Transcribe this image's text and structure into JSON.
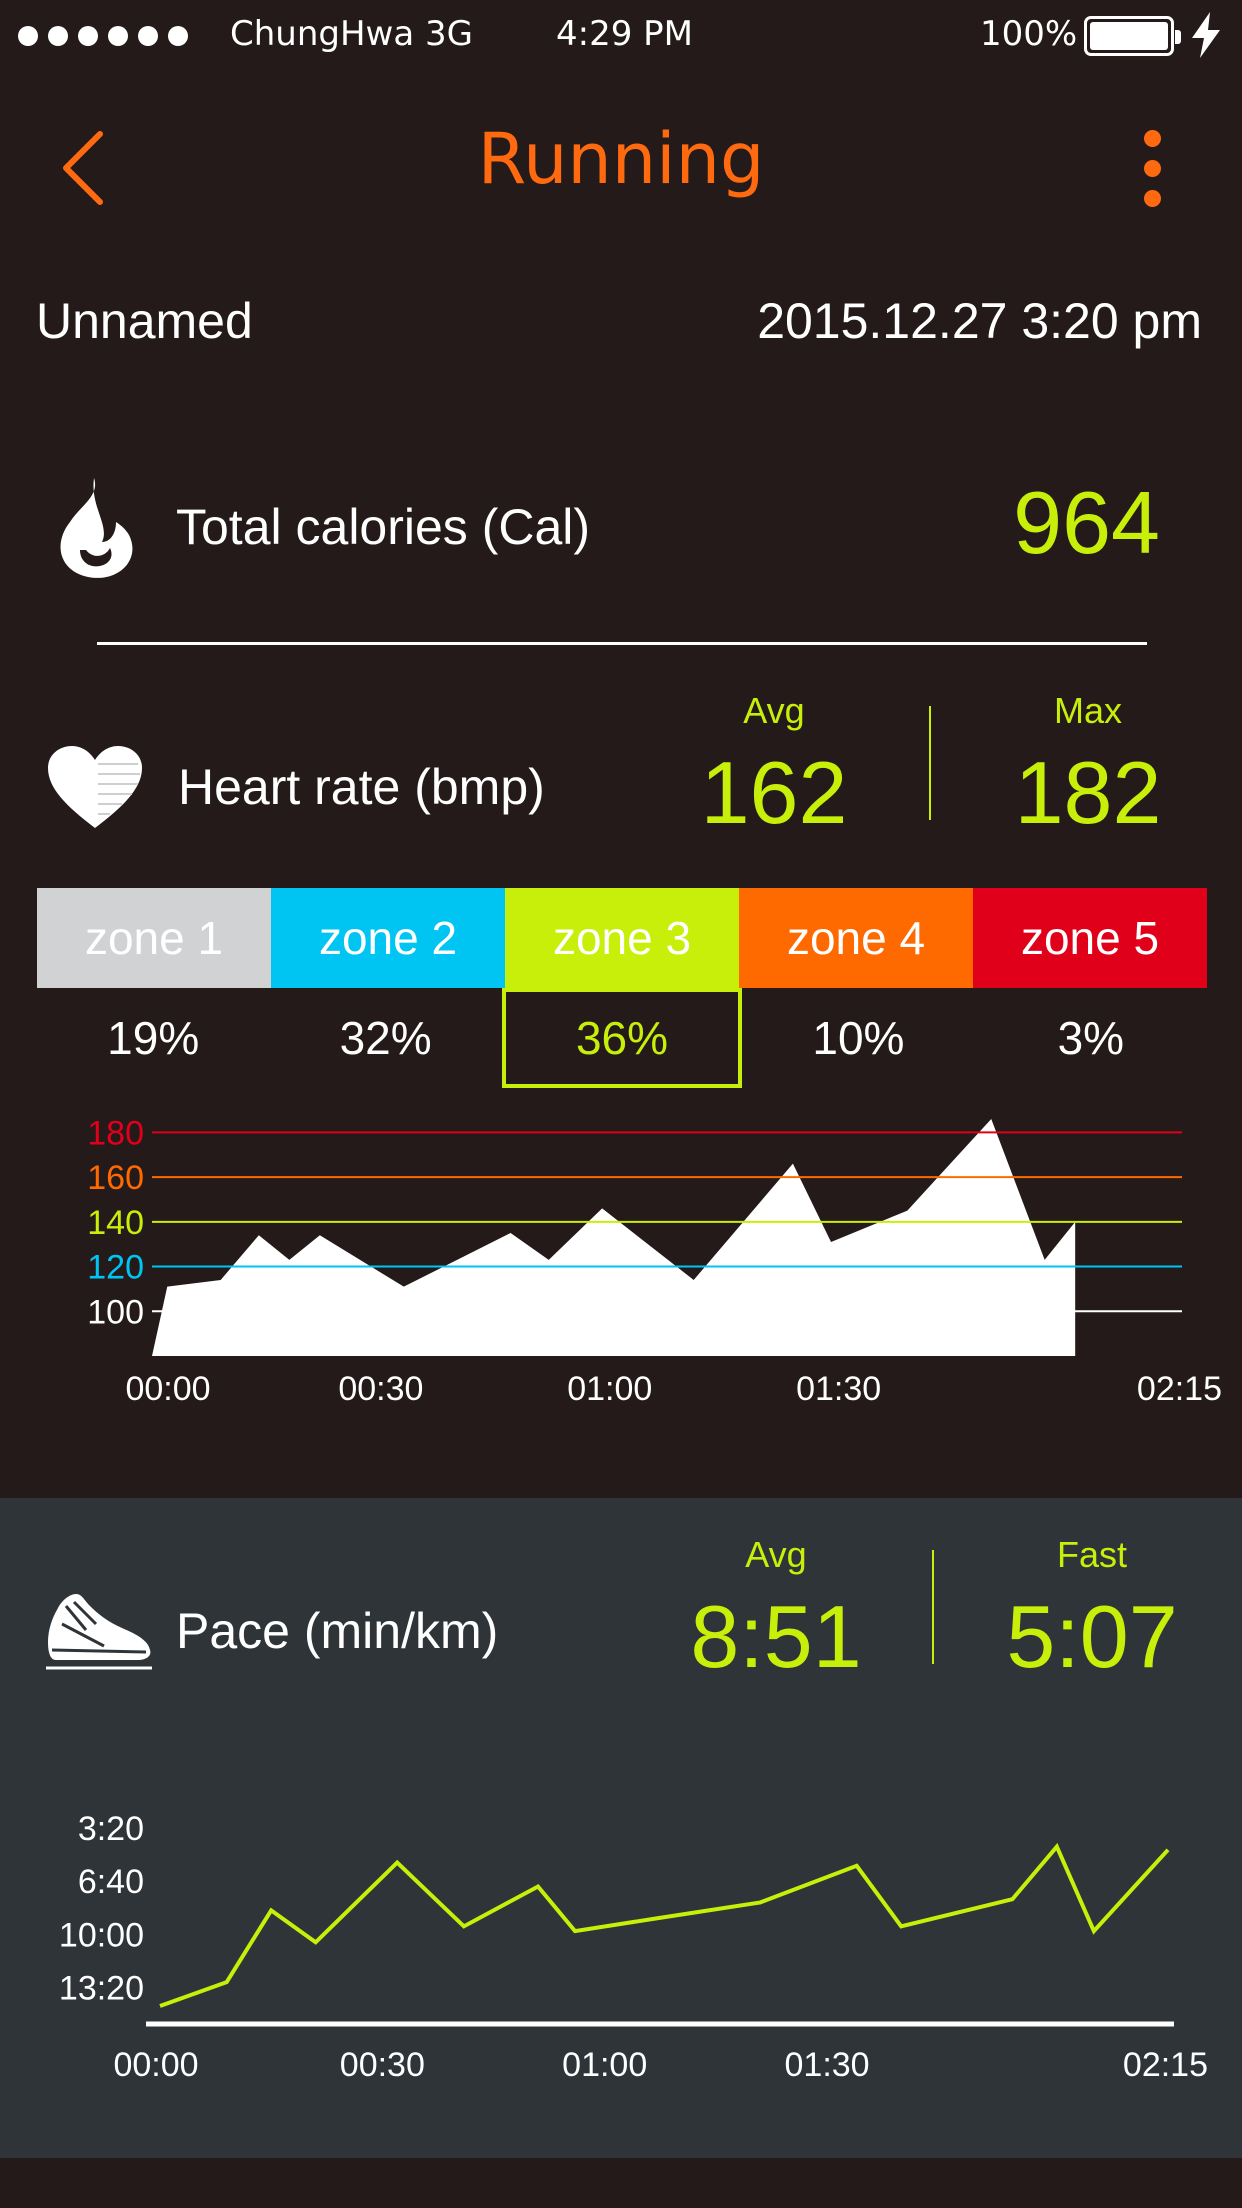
{
  "status_bar": {
    "carrier": "ChungHwa 3G",
    "time": "4:29 PM",
    "battery": "100%"
  },
  "nav": {
    "title": "Running"
  },
  "workout": {
    "name": "Unnamed",
    "datetime": "2015.12.27  3:20 pm"
  },
  "calories": {
    "label": "Total calories (Cal)",
    "value": "964"
  },
  "heart_rate": {
    "label": "Heart rate (bmp)",
    "avg_label": "Avg",
    "avg": "162",
    "max_label": "Max",
    "max": "182",
    "zones": [
      {
        "name": "zone 1",
        "pct": "19%",
        "color": "#d0d2d4"
      },
      {
        "name": "zone 2",
        "pct": "32%",
        "color": "#00c5f2"
      },
      {
        "name": "zone 3",
        "pct": "36%",
        "color": "#c7ef0a"
      },
      {
        "name": "zone 4",
        "pct": "10%",
        "color": "#ff6a00"
      },
      {
        "name": "zone 5",
        "pct": "3%",
        "color": "#e0001a"
      }
    ],
    "selected_zone": 2
  },
  "pace": {
    "label": "Pace (min/km)",
    "avg_label": "Avg",
    "avg": "8:51",
    "fast_label": "Fast",
    "fast": "5:07"
  },
  "colors": {
    "accent": "#ff6a10",
    "value": "#c7ef0a",
    "background": "#231a19",
    "pace_panel": "#2e3438"
  },
  "chart_data": [
    {
      "type": "area",
      "ylim": [
        80,
        190
      ],
      "ticks_y": [
        100,
        120,
        140,
        160,
        180
      ],
      "tick_labels_y": [
        "100",
        "120",
        "140",
        "160",
        "180"
      ],
      "tick_colors_y": [
        "#ffffff",
        "#00c5f2",
        "#c7ef0a",
        "#ff6a00",
        "#e0001a"
      ],
      "ticks_x": [
        0,
        30,
        60,
        90,
        135
      ],
      "tick_labels_x": [
        "00:00",
        "00:30",
        "01:00",
        "01:30",
        "02:15"
      ],
      "x": [
        0,
        2,
        9,
        14,
        18,
        22,
        33,
        47,
        52,
        59,
        71,
        84,
        89,
        99,
        110,
        117,
        121
      ],
      "values": [
        80,
        111,
        114,
        134,
        123,
        134,
        111,
        135,
        123,
        146,
        114,
        166,
        131,
        145,
        186,
        123,
        140
      ]
    },
    {
      "type": "line",
      "ylim": [
        14.5,
        2.2
      ],
      "ticks_y": [
        3.333,
        6.667,
        10.0,
        13.333
      ],
      "tick_labels_y": [
        "3:20",
        "6:40",
        "10:00",
        "13:20"
      ],
      "ticks_x": [
        0,
        30,
        60,
        90,
        135
      ],
      "tick_labels_x": [
        "00:00",
        "00:30",
        "01:00",
        "01:30",
        "02:15"
      ],
      "x": [
        0,
        9,
        15,
        21,
        32,
        41,
        51,
        56,
        67,
        81,
        94,
        100,
        115,
        121,
        126,
        136
      ],
      "values": [
        14.5,
        13.0,
        8.5,
        10.5,
        5.5,
        9.5,
        7.0,
        9.8,
        9.0,
        8.0,
        5.7,
        9.5,
        7.8,
        4.5,
        9.8,
        4.7
      ]
    }
  ]
}
